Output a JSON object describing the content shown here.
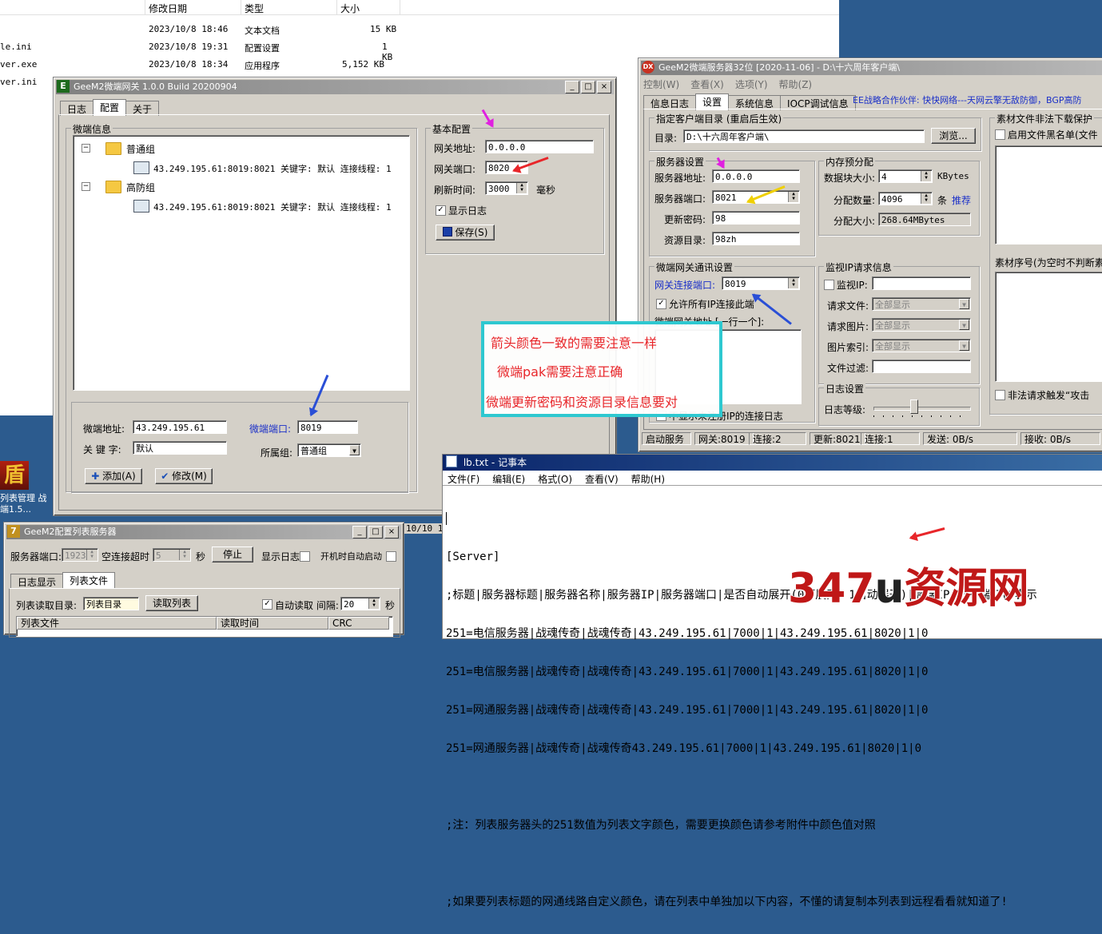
{
  "explorer": {
    "headers": [
      "修改日期",
      "类型",
      "大小"
    ],
    "rows": [
      {
        "name": "",
        "date": "2023/10/8 18:46",
        "type": "文本文档",
        "size": "15 KB"
      },
      {
        "name": "le.ini",
        "date": "2023/10/8 19:31",
        "type": "配置设置",
        "size": "1 KB"
      },
      {
        "name": "ver.exe",
        "date": "2023/10/8 18:34",
        "type": "应用程序",
        "size": "5,152 KB"
      },
      {
        "name": "ver.ini",
        "date": "",
        "type": "",
        "size": ""
      }
    ]
  },
  "desktop": {
    "icon_text": "盾",
    "label1": "列表管理 战",
    "label2": "端1.5..."
  },
  "gateway": {
    "title": "GeeM2微端网关 1.0.0 Build 20200904",
    "icon": "E",
    "tabs": [
      "日志",
      "配置",
      "关于"
    ],
    "tree_group_label": "微端信息",
    "tree": [
      {
        "group": "普通组",
        "item": "43.249.195.61:8019:8021 关键字: 默认 连接线程: 1"
      },
      {
        "group": "高防组",
        "item": "43.249.195.61:8019:8021 关键字: 默认 连接线程: 1"
      }
    ],
    "basic": {
      "label": "基本配置",
      "gw_addr_label": "网关地址:",
      "gw_addr": "0.0.0.0",
      "gw_port_label": "网关端口:",
      "gw_port": "8020",
      "refresh_label": "刷新时间:",
      "refresh": "3000",
      "refresh_unit": "毫秒",
      "show_log": "显示日志",
      "save": "保存(S)"
    },
    "bottom": {
      "addr_label": "微端地址:",
      "addr": "43.249.195.61",
      "port_label": "微端端口:",
      "port": "8019",
      "key_label": "关 键 字:",
      "key": "默认",
      "group_label": "所属组:",
      "group": "普通组",
      "add": "添加(A)",
      "edit": "修改(M)"
    }
  },
  "server": {
    "title": "GeeM2微端服务器32位 [2020-11-06] - D:\\十六周年客户端\\",
    "icon": "DX",
    "menu": [
      "控制(W)",
      "查看(X)",
      "选项(Y)",
      "帮助(Z)"
    ],
    "tabs": [
      "信息日志",
      "设置",
      "系统信息",
      "IOCP调试信息"
    ],
    "partner": "EE战略合作伙伴: 快快网络---天网云擎无敌防御，BGP高防",
    "dir_group": "指定客户端目录 (重启后生效)",
    "dir_label": "目录:",
    "dir": "D:\\十六周年客户端\\",
    "browse": "浏览...",
    "srv_group": "服务器设置",
    "srv_addr_label": "服务器地址:",
    "srv_addr": "0.0.0.0",
    "srv_port_label": "服务器端口:",
    "srv_port": "8021",
    "pwd_label": "更新密码:",
    "pwd": "98",
    "res_label": "资源目录:",
    "res": "98zh",
    "mem_group": "内存预分配",
    "block_label": "数据块大小:",
    "block": "4",
    "block_unit": "KBytes",
    "count_label": "分配数量:",
    "count": "4096",
    "count_unit": "条",
    "recommend": "推荐",
    "alloc_label": "分配大小:",
    "alloc": "268.64MBytes",
    "gw_group": "微端网关通讯设置",
    "gw_port_label": "网关连接端口:",
    "gw_port": "8019",
    "allow_all": "允许所有IP连接此端",
    "gw_addr_label": "微端网关地址 [一行一个]:",
    "no_show": "不显示未注册IP的连接日志",
    "monitor_group": "监视IP请求信息",
    "mon_ip": "监视IP:",
    "req_file": "请求文件:",
    "req_img": "请求图片:",
    "img_idx": "图片索引:",
    "all_show": "全部显示",
    "file_filter": "文件过滤:",
    "log_group": "日志设置",
    "log_level": "日志等级:",
    "res_group": "素材文件非法下载保护",
    "blacklist": "启用文件黑名单(文件",
    "seq_label": "素材序号(为空时不判断素",
    "illegal": "非法请求触发“攻击",
    "status": [
      "启动服务",
      "网关:8019",
      "连接:2",
      "更新:8021",
      "连接:1",
      "发送: 0B/s",
      "接收: 0B/s"
    ]
  },
  "notepad": {
    "title": "lb.txt - 记事本",
    "menu": [
      "文件(F)",
      "编辑(E)",
      "格式(O)",
      "查看(V)",
      "帮助(H)"
    ],
    "lines": [
      "",
      "[Server]",
      ";标题|服务器标题|服务器名称|服务器IP|服务器端口|是否自动展开(0不展开，1自动展开)|微端IP|微端端口(0表示",
      "251=电信服务器|战魂传奇|战魂传奇|43.249.195.61|7000|1|43.249.195.61|8020|1|0",
      "251=电信服务器|战魂传奇|战魂传奇|43.249.195.61|7000|1|43.249.195.61|8020|1|0",
      "251=网通服务器|战魂传奇|战魂传奇|43.249.195.61|7000|1|43.249.195.61|8020|1|0",
      "251=网通服务器|战魂传奇|战魂传奇43.249.195.61|7000|1|43.249.195.61|8020|1|0",
      "",
      ";注：列表服务器头的251数值为列表文字颜色，需要更换颜色请参考附件中颜色值对照",
      "",
      ";如果要列表标题的网通线路自定义颜色，请在列表中单独加以下内容，不懂的请复制本列表到远程看看就知道了!"
    ]
  },
  "listcfg": {
    "title": "GeeM2配置列表服务器",
    "port_label": "服务器端口:",
    "port": "1923",
    "timeout_label": "空连接超时",
    "timeout": "5",
    "sec": "秒",
    "stop": "停止",
    "show_log": "显示日志",
    "auto_start": "开机时自动启动",
    "tabs": [
      "日志显示",
      "列表文件"
    ],
    "dir_label": "列表读取目录:",
    "dir": "列表目录",
    "read": "读取列表",
    "auto_read": "自动读取 间隔:",
    "interval": "20",
    "sec2": "秒",
    "cols": [
      "列表文件",
      "读取时间",
      "CRC"
    ],
    "date_frag": "10/10 1"
  },
  "annotation": {
    "line1": "箭头颜色一致的需要注意一样",
    "line2": "微端pak需要注意正确",
    "line3": "微端更新密码和资源目录信息要对",
    "border_color": "#2ec8d0",
    "text_color": "#e8262a"
  },
  "watermark": {
    "num": "347",
    "letter": "u",
    "cn": "资源网"
  },
  "colors": {
    "magenta": "#e020e0",
    "red": "#e8262a",
    "yellow": "#f0d000",
    "blue": "#2a4fd6"
  }
}
